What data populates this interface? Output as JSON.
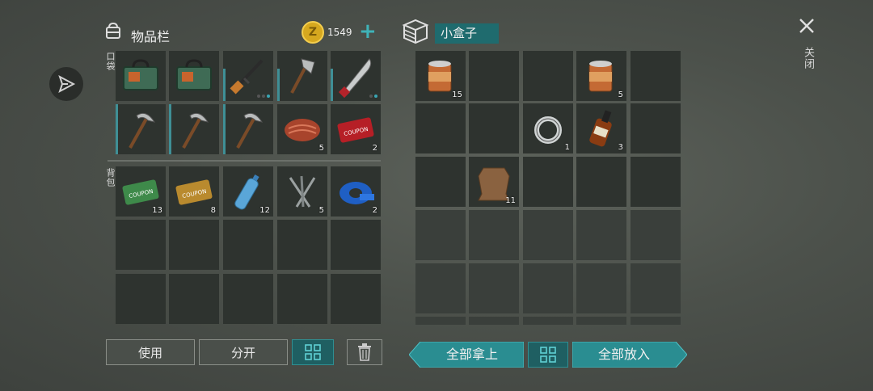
{
  "inventory": {
    "title": "物品栏",
    "coins": "1549",
    "pocket_label": "口袋",
    "backpack_label": "背包",
    "pocket_slots": [
      {
        "icon": "toolbox-icon",
        "qty": ""
      },
      {
        "icon": "toolbox-icon",
        "qty": ""
      },
      {
        "icon": "rifle-icon",
        "qty": ""
      },
      {
        "icon": "hatchet-icon",
        "qty": ""
      },
      {
        "icon": "machete-icon",
        "qty": ""
      },
      {
        "icon": "pickaxe-icon",
        "qty": ""
      },
      {
        "icon": "pickaxe-icon",
        "qty": ""
      },
      {
        "icon": "pickaxe-icon",
        "qty": ""
      },
      {
        "icon": "meat-icon",
        "qty": "5"
      },
      {
        "icon": "coupon-red-icon",
        "qty": "2"
      }
    ],
    "backpack_slots": [
      {
        "icon": "coupon-green-icon",
        "qty": "13"
      },
      {
        "icon": "coupon-gold-icon",
        "qty": "8"
      },
      {
        "icon": "water-bottle-icon",
        "qty": "12"
      },
      {
        "icon": "nails-icon",
        "qty": "5"
      },
      {
        "icon": "tape-icon",
        "qty": "2"
      }
    ],
    "buttons": {
      "use": "使用",
      "split": "分开"
    }
  },
  "container": {
    "title": "小盒子",
    "close_label": "关闭",
    "slots": [
      {
        "row": 0,
        "col": 0,
        "icon": "canned-food-icon",
        "qty": "15"
      },
      {
        "row": 0,
        "col": 3,
        "icon": "canned-food-icon",
        "qty": "5"
      },
      {
        "row": 1,
        "col": 2,
        "icon": "bearing-ring-icon",
        "qty": "1"
      },
      {
        "row": 1,
        "col": 3,
        "icon": "whiskey-bottle-icon",
        "qty": "3"
      },
      {
        "row": 2,
        "col": 1,
        "icon": "leather-hide-icon",
        "qty": "11"
      }
    ],
    "buttons": {
      "take_all": "全部拿上",
      "put_all": "全部放入"
    }
  },
  "colors": {
    "accent": "#2a8d91",
    "slot": "#2e332f",
    "coin": "#e0b020"
  }
}
